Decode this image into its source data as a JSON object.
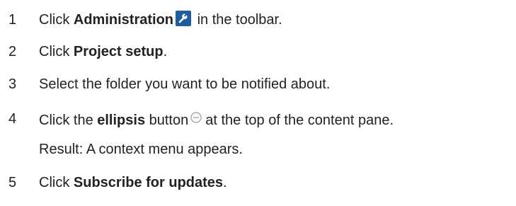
{
  "steps": [
    {
      "number": "1",
      "pre": "Click ",
      "bold": "Administration",
      "icon": "wrench-icon",
      "post": " in the toolbar."
    },
    {
      "number": "2",
      "pre": "Click ",
      "bold": "Project setup",
      "post": "."
    },
    {
      "number": "3",
      "text": "Select the folder you want to be notified about."
    },
    {
      "number": "4",
      "pre": "Click the ",
      "bold": "ellipsis",
      "mid": " button",
      "icon": "ellipsis-icon",
      "post": "at the top of the content pane.",
      "result": "Result: A context menu appears."
    },
    {
      "number": "5",
      "pre": "Click ",
      "bold": "Subscribe for updates",
      "post": "."
    }
  ],
  "colors": {
    "text": "#222222",
    "admin_icon_bg": "#1d5f9c",
    "ellipsis_icon_stroke": "#9a9a9a"
  }
}
